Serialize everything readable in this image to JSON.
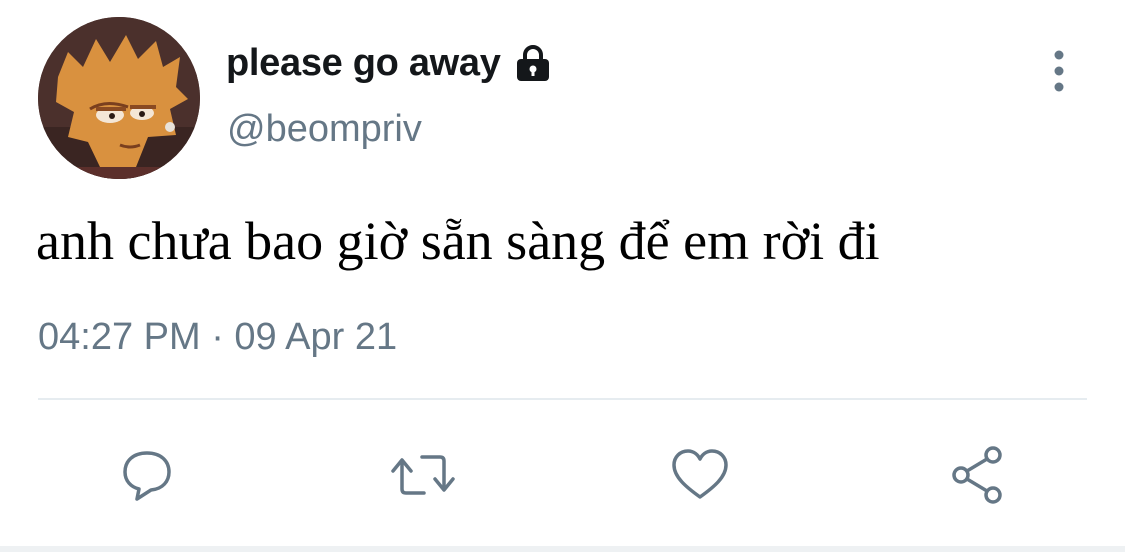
{
  "tweet": {
    "display_name": "please go away",
    "handle": "@beompriv",
    "text": "anh chưa bao giờ sẵn sàng để em rời đi",
    "timestamp": "04:27 PM · 09 Apr 21",
    "protected": true
  },
  "icons": {
    "avatar": "cartoon-avatar",
    "lock": "lock-icon",
    "more": "more-vertical-icon",
    "reply": "reply-icon",
    "retweet": "retweet-icon",
    "like": "heart-icon",
    "share": "share-icon"
  },
  "colors": {
    "text_primary": "#14171a",
    "text_secondary": "#657786",
    "icon_gray": "#657786",
    "divider": "#e6ecf0"
  }
}
